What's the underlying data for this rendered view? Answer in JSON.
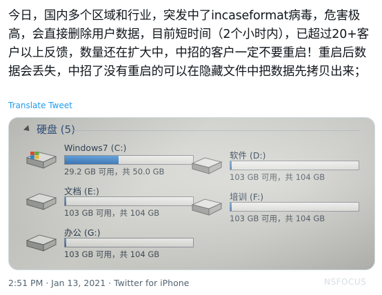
{
  "tweet": {
    "text": "今日，国内多个区域和行业，突发中了incaseformat病毒，危害极高，会直接删除用户数据，目前短时间（2个小时内），已超过20+客户以上反馈，数量还在扩大中，中招的客户一定不要重启！重启后数据会丢失，中招了没有重启的可以在隐藏文件中把数据先拷贝出来；",
    "translate_label": "Translate Tweet",
    "timestamp": "2:51 PM · Jan 13, 2021 · Twitter for iPhone"
  },
  "photo": {
    "section_label": "硬盘 (5)",
    "drives": [
      {
        "name": "Windows7 (C:)",
        "space": "29.2 GB 可用，共 50.0 GB",
        "used_fraction": 0.42,
        "icon": "windows-drive-icon"
      },
      {
        "name": "软件 (D:)",
        "space": "103 GB 可用，共 104 GB",
        "used_fraction": 0.01,
        "icon": "hard-drive-icon"
      },
      {
        "name": "文档 (E:)",
        "space": "103 GB 可用，共 104 GB",
        "used_fraction": 0.01,
        "icon": "hard-drive-icon"
      },
      {
        "name": "培训 (F:)",
        "space": "103 GB 可用，共 104 GB",
        "used_fraction": 0.01,
        "icon": "hard-drive-icon"
      },
      {
        "name": "办公 (G:)",
        "space": "103 GB 可用，共 104 GB",
        "used_fraction": 0.01,
        "icon": "hard-drive-icon"
      }
    ]
  },
  "watermark": "NSFOCUS",
  "colors": {
    "link": "#1d9bf0",
    "bar_fill": "#2d6fb8",
    "meta": "#536471"
  }
}
